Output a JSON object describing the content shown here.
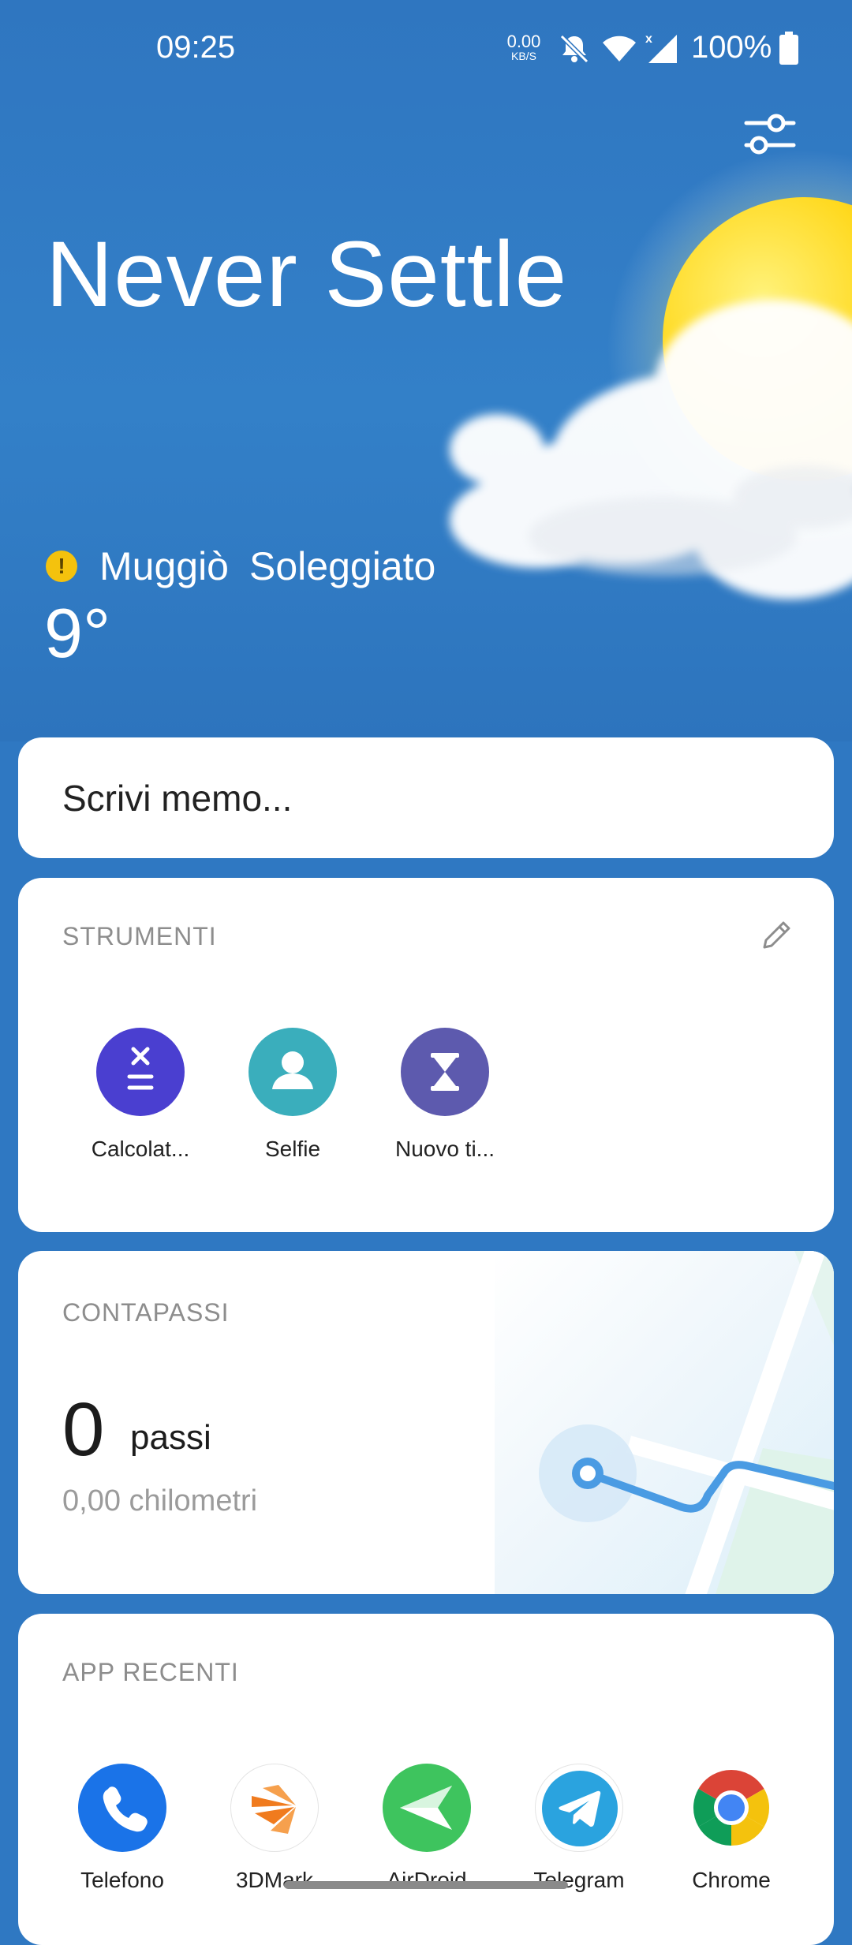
{
  "status_bar": {
    "time": "09:25",
    "net_speed_value": "0.00",
    "net_speed_unit": "KB/S",
    "battery": "100%"
  },
  "header": {
    "headline": "Never Settle"
  },
  "weather": {
    "city": "Muggiò",
    "condition": "Soleggiato",
    "temperature": "9°",
    "alert_symbol": "!"
  },
  "memo": {
    "placeholder": "Scrivi memo..."
  },
  "tools": {
    "title": "STRUMENTI",
    "items": [
      {
        "label": "Calcolat...",
        "color": "#4a3fd0",
        "icon": "calculator-icon"
      },
      {
        "label": "Selfie",
        "color": "#3aaebc",
        "icon": "person-icon"
      },
      {
        "label": "Nuovo ti...",
        "color": "#5d5aae",
        "icon": "hourglass-icon"
      }
    ]
  },
  "pedometer": {
    "title": "CONTAPASSI",
    "steps": "0",
    "steps_unit": "passi",
    "distance": "0,00 chilometri"
  },
  "recent_apps": {
    "title": "APP RECENTI",
    "items": [
      {
        "label": "Telefono",
        "icon": "phone-icon"
      },
      {
        "label": "3DMark",
        "icon": "3dmark-icon"
      },
      {
        "label": "AirDroid",
        "icon": "airdroid-icon"
      },
      {
        "label": "Telegram",
        "icon": "telegram-icon"
      },
      {
        "label": "Chrome",
        "icon": "chrome-icon"
      }
    ]
  },
  "colors": {
    "background": "#2f78c2",
    "alert": "#f4c20d"
  }
}
